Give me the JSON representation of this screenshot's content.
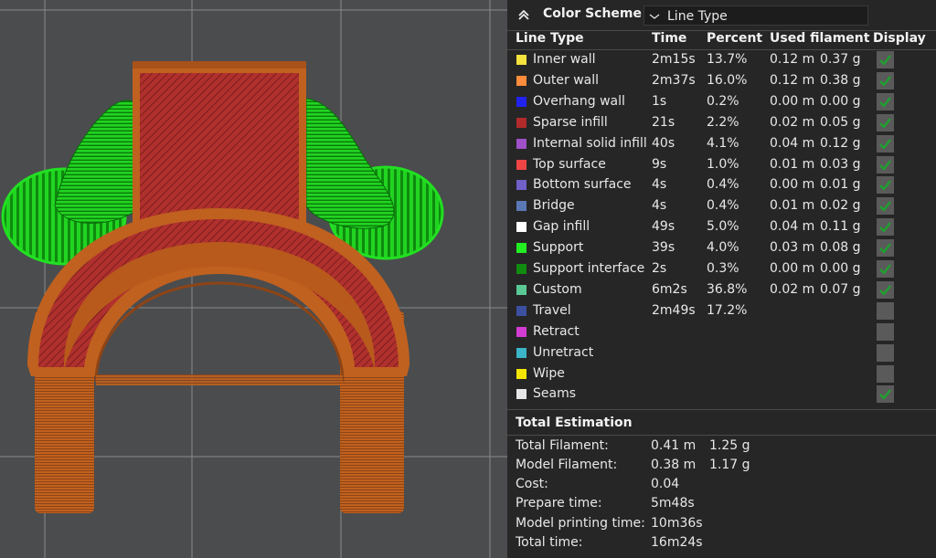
{
  "header": {
    "title": "Color Scheme",
    "scheme_value": "Line Type"
  },
  "columns": {
    "line_type": "Line Type",
    "time": "Time",
    "percent": "Percent",
    "used_filament": "Used filament",
    "display": "Display"
  },
  "rows": [
    {
      "name": "Inner wall",
      "color": "#f5e23c",
      "time": "2m15s",
      "percent": "13.7%",
      "length": "0.12 m",
      "weight": "0.37 g",
      "display": true
    },
    {
      "name": "Outer wall",
      "color": "#ff8c3c",
      "time": "2m37s",
      "percent": "16.0%",
      "length": "0.12 m",
      "weight": "0.38 g",
      "display": true
    },
    {
      "name": "Overhang wall",
      "color": "#2222ee",
      "time": "1s",
      "percent": "0.2%",
      "length": "0.00 m",
      "weight": "0.00 g",
      "display": true
    },
    {
      "name": "Sparse infill",
      "color": "#b22a2a",
      "time": "21s",
      "percent": "2.2%",
      "length": "0.02 m",
      "weight": "0.05 g",
      "display": true
    },
    {
      "name": "Internal solid infill",
      "color": "#a050c8",
      "time": "40s",
      "percent": "4.1%",
      "length": "0.04 m",
      "weight": "0.12 g",
      "display": true
    },
    {
      "name": "Top surface",
      "color": "#ee4444",
      "time": "9s",
      "percent": "1.0%",
      "length": "0.01 m",
      "weight": "0.03 g",
      "display": true
    },
    {
      "name": "Bottom surface",
      "color": "#7060c8",
      "time": "4s",
      "percent": "0.4%",
      "length": "0.00 m",
      "weight": "0.01 g",
      "display": true
    },
    {
      "name": "Bridge",
      "color": "#5a78b4",
      "time": "4s",
      "percent": "0.4%",
      "length": "0.01 m",
      "weight": "0.02 g",
      "display": true
    },
    {
      "name": "Gap infill",
      "color": "#ffffff",
      "time": "49s",
      "percent": "5.0%",
      "length": "0.04 m",
      "weight": "0.11 g",
      "display": true
    },
    {
      "name": "Support",
      "color": "#22ee22",
      "time": "39s",
      "percent": "4.0%",
      "length": "0.03 m",
      "weight": "0.08 g",
      "display": true
    },
    {
      "name": "Support interface",
      "color": "#108c10",
      "time": "2s",
      "percent": "0.3%",
      "length": "0.00 m",
      "weight": "0.00 g",
      "display": true
    },
    {
      "name": "Custom",
      "color": "#5ac894",
      "time": "6m2s",
      "percent": "36.8%",
      "length": "0.02 m",
      "weight": "0.07 g",
      "display": true
    },
    {
      "name": "Travel",
      "color": "#3c50a0",
      "time": "2m49s",
      "percent": "17.2%",
      "length": "",
      "weight": "",
      "display": false
    },
    {
      "name": "Retract",
      "color": "#d23cd2",
      "time": "",
      "percent": "",
      "length": "",
      "weight": "",
      "display": false
    },
    {
      "name": "Unretract",
      "color": "#3cb4c8",
      "time": "",
      "percent": "",
      "length": "",
      "weight": "",
      "display": false
    },
    {
      "name": "Wipe",
      "color": "#f5e600",
      "time": "",
      "percent": "",
      "length": "",
      "weight": "",
      "display": false
    },
    {
      "name": "Seams",
      "color": "#e6e6e6",
      "time": "",
      "percent": "",
      "length": "",
      "weight": "",
      "display": true
    }
  ],
  "totals": {
    "title": "Total Estimation",
    "total_filament_label": "Total Filament:",
    "total_filament_length": "0.41 m",
    "total_filament_weight": "1.25 g",
    "model_filament_label": "Model Filament:",
    "model_filament_length": "0.38 m",
    "model_filament_weight": "1.17 g",
    "cost_label": "Cost:",
    "cost_value": "0.04",
    "prepare_label": "Prepare time:",
    "prepare_value": "5m48s",
    "model_print_label": "Model printing time:",
    "model_print_value": "10m36s",
    "total_time_label": "Total time:",
    "total_time_value": "16m24s"
  },
  "colors": {
    "model_orange": "#c0611f",
    "support_green": "#1ec81e",
    "infill_red": "#b22a2a",
    "check_green": "#1fa02f",
    "panel_bg": "#262626"
  }
}
